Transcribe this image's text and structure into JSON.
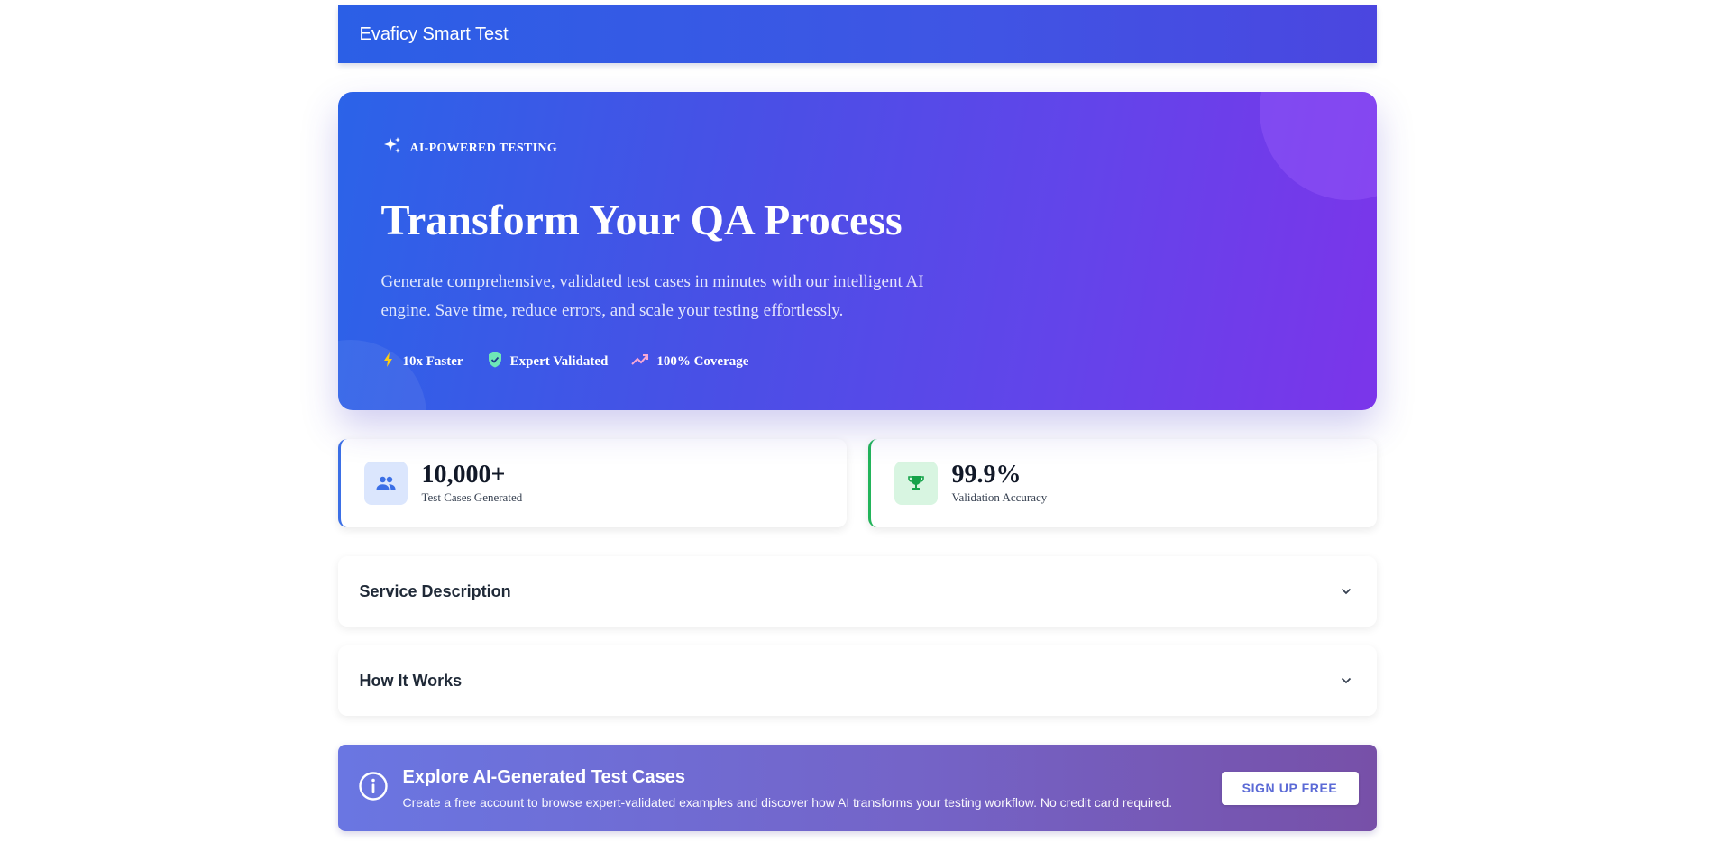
{
  "header": {
    "title": "Evaficy Smart Test"
  },
  "hero": {
    "eyebrow": "AI-POWERED TESTING",
    "eyebrow_icon": "sparkles-icon",
    "title": "Transform Your QA Process",
    "description": "Generate comprehensive, validated test cases in minutes with our intelligent AI engine. Save time, reduce errors, and scale your testing effortlessly.",
    "features": [
      {
        "icon": "lightning-icon",
        "label": "10x Faster",
        "color": "#facc15"
      },
      {
        "icon": "shield-check-icon",
        "label": "Expert Validated",
        "color": "#6ee7b7"
      },
      {
        "icon": "trending-up-icon",
        "label": "100% Coverage",
        "color": "#f9a8d4"
      }
    ]
  },
  "stats": [
    {
      "icon": "users-icon",
      "value": "10,000+",
      "label": "Test Cases Generated",
      "accent": "#3b6fe6"
    },
    {
      "icon": "trophy-icon",
      "value": "99.9%",
      "label": "Validation Accuracy",
      "accent": "#22b45a"
    }
  ],
  "accordions": [
    {
      "title": "Service Description",
      "icon": "chevron-down-icon"
    },
    {
      "title": "How It Works",
      "icon": "chevron-down-icon"
    }
  ],
  "cta": {
    "icon": "info-icon",
    "title": "Explore AI-Generated Test Cases",
    "description": "Create a free account to browse expert-validated examples and discover how AI transforms your testing workflow. No credit card required.",
    "button_label": "SIGN UP FREE"
  }
}
